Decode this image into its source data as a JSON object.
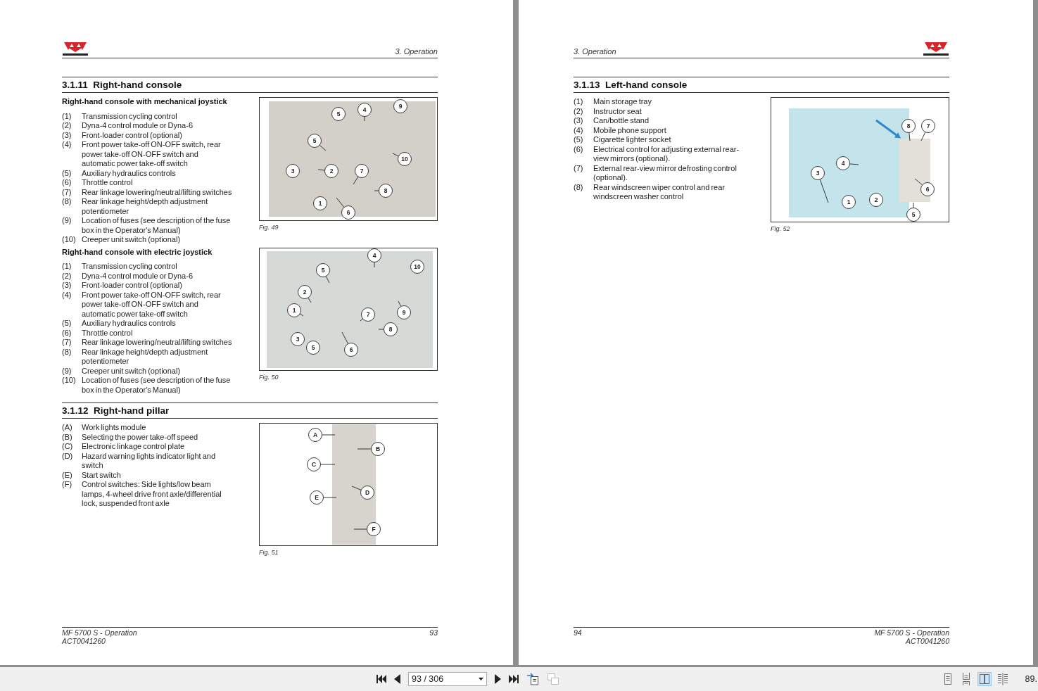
{
  "pages": [
    {
      "header": {
        "chapter": "3. Operation"
      },
      "sections": [
        {
          "heading": "3.1.11  Right-hand console",
          "blocks": [
            {
              "subheading": "Right-hand console with mechanical joystick",
              "items": [
                {
                  "marker": "(1)",
                  "text": "Transmission cycling control"
                },
                {
                  "marker": "(2)",
                  "text": "Dyna-4 control module or Dyna-6"
                },
                {
                  "marker": "(3)",
                  "text": "Front-loader control (optional)"
                },
                {
                  "marker": "(4)",
                  "text": "Front power take-off ON-OFF switch, rear power take-off ON-OFF switch and automatic power take-off switch"
                },
                {
                  "marker": "(5)",
                  "text": "Auxiliary hydraulics controls"
                },
                {
                  "marker": "(6)",
                  "text": "Throttle control"
                },
                {
                  "marker": "(7)",
                  "text": "Rear linkage lowering/neutral/lifting switches"
                },
                {
                  "marker": "(8)",
                  "text": "Rear linkage height/depth adjustment potentiometer"
                },
                {
                  "marker": "(9)",
                  "text": "Location of fuses (see description of the fuse box in the Operator's Manual)"
                },
                {
                  "marker": "(10)",
                  "text": "Creeper unit switch (optional)"
                }
              ],
              "figure": {
                "caption": "Fig. 49",
                "callouts": [
                  "9",
                  "4",
                  "5",
                  "5",
                  "10",
                  "3",
                  "2",
                  "7",
                  "8",
                  "1",
                  "6"
                ]
              }
            },
            {
              "subheading": "Right-hand console with electric joystick",
              "items": [
                {
                  "marker": "(1)",
                  "text": "Transmission cycling control"
                },
                {
                  "marker": "(2)",
                  "text": "Dyna-4 control module or Dyna-6"
                },
                {
                  "marker": "(3)",
                  "text": "Front-loader control (optional)"
                },
                {
                  "marker": "(4)",
                  "text": "Front power take-off ON-OFF switch, rear power take-off ON-OFF switch and automatic power take-off switch"
                },
                {
                  "marker": "(5)",
                  "text": "Auxiliary hydraulics controls"
                },
                {
                  "marker": "(6)",
                  "text": "Throttle control"
                },
                {
                  "marker": "(7)",
                  "text": "Rear linkage lowering/neutral/lifting switches"
                },
                {
                  "marker": "(8)",
                  "text": "Rear linkage height/depth adjustment potentiometer"
                },
                {
                  "marker": "(9)",
                  "text": "Creeper unit switch (optional)"
                },
                {
                  "marker": "(10)",
                  "text": "Location of fuses (see description of the fuse box in the Operator's Manual)"
                }
              ],
              "figure": {
                "caption": "Fig. 50",
                "callouts": [
                  "4",
                  "5",
                  "10",
                  "2",
                  "1",
                  "7",
                  "9",
                  "8",
                  "3",
                  "5",
                  "6"
                ]
              }
            }
          ]
        },
        {
          "heading": "3.1.12  Right-hand pillar",
          "blocks": [
            {
              "items": [
                {
                  "marker": "(A)",
                  "text": "Work lights module"
                },
                {
                  "marker": "(B)",
                  "text": "Selecting the power take-off speed"
                },
                {
                  "marker": "(C)",
                  "text": "Electronic linkage control plate"
                },
                {
                  "marker": "(D)",
                  "text": "Hazard warning lights indicator light and switch"
                },
                {
                  "marker": "(E)",
                  "text": "Start switch"
                },
                {
                  "marker": "(F)",
                  "text": "Control switches: Side lights/low beam lamps, 4-wheel drive front axle/differential lock, suspended front axle"
                }
              ],
              "figure": {
                "caption": "Fig. 51",
                "callouts": [
                  "A",
                  "B",
                  "C",
                  "D",
                  "E",
                  "F"
                ]
              }
            }
          ]
        }
      ],
      "footer": {
        "title": "MF 5700 S - Operation",
        "doc_id": "ACT0041260",
        "page_number": "93"
      }
    },
    {
      "header": {
        "chapter": "3. Operation"
      },
      "sections": [
        {
          "heading": "3.1.13  Left-hand console",
          "blocks": [
            {
              "items": [
                {
                  "marker": "(1)",
                  "text": "Main storage tray"
                },
                {
                  "marker": "(2)",
                  "text": "Instructor seat"
                },
                {
                  "marker": "(3)",
                  "text": "Can/bottle stand"
                },
                {
                  "marker": "(4)",
                  "text": "Mobile phone support"
                },
                {
                  "marker": "(5)",
                  "text": "Cigarette lighter socket"
                },
                {
                  "marker": "(6)",
                  "text": "Electrical control for adjusting external rear-view mirrors (optional)."
                },
                {
                  "marker": "(7)",
                  "text": "External rear-view mirror defrosting control (optional)."
                },
                {
                  "marker": "(8)",
                  "text": "Rear windscreen wiper control and rear windscreen washer control"
                }
              ],
              "figure": {
                "caption": "Fig. 52",
                "callouts": [
                  "8",
                  "7",
                  "4",
                  "3",
                  "6",
                  "1",
                  "2",
                  "5"
                ]
              }
            }
          ]
        }
      ],
      "footer": {
        "title": "MF 5700 S - Operation",
        "doc_id": "ACT0041260",
        "page_number": "94"
      }
    }
  ],
  "toolbar": {
    "page_field": {
      "value": "93 / 306"
    },
    "tools": [
      {
        "disabled": false
      },
      {
        "disabled": true
      }
    ],
    "view_modes": [
      {
        "selected": false
      },
      {
        "selected": false
      },
      {
        "selected": true
      },
      {
        "selected": false
      }
    ],
    "zoom": {
      "value": "89."
    }
  }
}
